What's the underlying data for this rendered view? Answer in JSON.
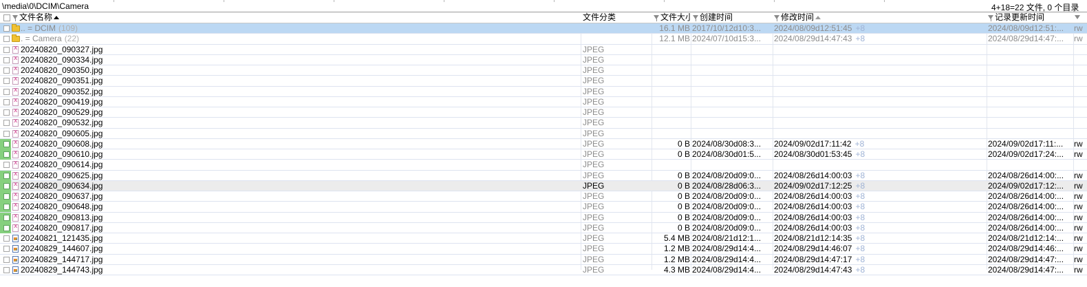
{
  "path": {
    "current": "\\media\\0\\DCIM\\Camera",
    "summary": "4+18=22 文件, 0 个目录"
  },
  "columns": {
    "name": "文件名称",
    "type": "文件分类",
    "size": "文件大小",
    "created": "创建时间",
    "modified": "修改时间",
    "record": "记录更新时间"
  },
  "rows": [
    {
      "kind": "folder",
      "name": "..  =  DCIM",
      "extra": "(109)",
      "type": "",
      "size": "16.1 MB",
      "created": "2017/10/12d10:3...",
      "modified": "2024/08/09d12:51:45",
      "tz": "+8",
      "record": "2024/08/09d12:51:...",
      "tail": "rw",
      "selected": true
    },
    {
      "kind": "folder",
      "name": ".   =  Camera",
      "extra": "(22)",
      "type": "",
      "size": "12.1 MB",
      "created": "2024/07/10d15:3...",
      "modified": "2024/08/29d14:47:43",
      "tz": "+8",
      "record": "2024/08/29d14:47:...",
      "tail": "rw"
    },
    {
      "kind": "file",
      "name": "20240820_090327.jpg",
      "type": "JPEG"
    },
    {
      "kind": "file",
      "name": "20240820_090334.jpg",
      "type": "JPEG"
    },
    {
      "kind": "file",
      "name": "20240820_090350.jpg",
      "type": "JPEG"
    },
    {
      "kind": "file",
      "name": "20240820_090351.jpg",
      "type": "JPEG"
    },
    {
      "kind": "file",
      "name": "20240820_090352.jpg",
      "type": "JPEG"
    },
    {
      "kind": "file",
      "name": "20240820_090419.jpg",
      "type": "JPEG"
    },
    {
      "kind": "file",
      "name": "20240820_090529.jpg",
      "type": "JPEG"
    },
    {
      "kind": "file",
      "name": "20240820_090532.jpg",
      "type": "JPEG"
    },
    {
      "kind": "file",
      "name": "20240820_090605.jpg",
      "type": "JPEG"
    },
    {
      "kind": "file",
      "name": "20240820_090608.jpg",
      "type": "JPEG",
      "size": "0 B",
      "created": "2024/08/30d08:3...",
      "modified": "2024/09/02d17:11:42",
      "tz": "+8",
      "record": "2024/09/02d17:11:...",
      "tail": "rw",
      "marked": true
    },
    {
      "kind": "file",
      "name": "20240820_090610.jpg",
      "type": "JPEG",
      "size": "0 B",
      "created": "2024/08/30d01:5...",
      "modified": "2024/08/30d01:53:45",
      "tz": "+8",
      "record": "2024/09/02d17:24:...",
      "tail": "rw",
      "marked": true
    },
    {
      "kind": "file",
      "name": "20240820_090614.jpg",
      "type": "JPEG"
    },
    {
      "kind": "file",
      "name": "20240820_090625.jpg",
      "type": "JPEG",
      "size": "0 B",
      "created": "2024/08/20d09:0...",
      "modified": "2024/08/26d14:00:03",
      "tz": "+8",
      "record": "2024/08/26d14:00:...",
      "tail": "rw",
      "marked": true
    },
    {
      "kind": "file",
      "name": "20240820_090634.jpg",
      "type": "JPEG",
      "size": "0 B",
      "created": "2024/08/28d06:3...",
      "modified": "2024/09/02d17:12:25",
      "tz": "+8",
      "record": "2024/09/02d17:12:...",
      "tail": "rw",
      "marked": true,
      "hover": true
    },
    {
      "kind": "file",
      "name": "20240820_090637.jpg",
      "type": "JPEG",
      "size": "0 B",
      "created": "2024/08/20d09:0...",
      "modified": "2024/08/26d14:00:03",
      "tz": "+8",
      "record": "2024/08/26d14:00:...",
      "tail": "rw",
      "marked": true
    },
    {
      "kind": "file",
      "name": "20240820_090648.jpg",
      "type": "JPEG",
      "size": "0 B",
      "created": "2024/08/20d09:0...",
      "modified": "2024/08/26d14:00:03",
      "tz": "+8",
      "record": "2024/08/26d14:00:...",
      "tail": "rw",
      "marked": true
    },
    {
      "kind": "file",
      "name": "20240820_090813.jpg",
      "type": "JPEG",
      "size": "0 B",
      "created": "2024/08/20d09:0...",
      "modified": "2024/08/26d14:00:03",
      "tz": "+8",
      "record": "2024/08/26d14:00:...",
      "tail": "rw",
      "marked": true
    },
    {
      "kind": "file",
      "name": "20240820_090817.jpg",
      "type": "JPEG",
      "size": "0 B",
      "created": "2024/08/20d09:0...",
      "modified": "2024/08/26d14:00:03",
      "tz": "+8",
      "record": "2024/08/26d14:00:...",
      "tail": "rw",
      "marked": true
    },
    {
      "kind": "image",
      "name": "20240821_121435.jpg",
      "type": "JPEG",
      "size": "5.4 MB",
      "created": "2024/08/21d12:1...",
      "modified": "2024/08/21d12:14:35",
      "tz": "+8",
      "record": "2024/08/21d12:14:...",
      "tail": "rw"
    },
    {
      "kind": "image",
      "name": "20240829_144607.jpg",
      "type": "JPEG",
      "size": "1.2 MB",
      "created": "2024/08/29d14:4...",
      "modified": "2024/08/29d14:46:07",
      "tz": "+8",
      "record": "2024/08/29d14:46:...",
      "tail": "rw"
    },
    {
      "kind": "image",
      "name": "20240829_144717.jpg",
      "type": "JPEG",
      "size": "1.2 MB",
      "created": "2024/08/29d14:4...",
      "modified": "2024/08/29d14:47:17",
      "tz": "+8",
      "record": "2024/08/29d14:47:...",
      "tail": "rw"
    },
    {
      "kind": "image",
      "name": "20240829_144743.jpg",
      "type": "JPEG",
      "size": "4.3 MB",
      "created": "2024/08/29d14:4...",
      "modified": "2024/08/29d14:47:43",
      "tz": "+8",
      "record": "2024/08/29d14:47:...",
      "tail": "rw"
    }
  ]
}
